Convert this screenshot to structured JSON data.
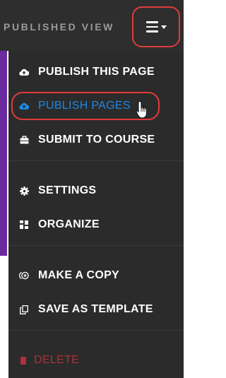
{
  "header": {
    "title": "PUBLISHED VIEW",
    "menu_toggle": "hamburger-menu"
  },
  "menu": {
    "items": [
      {
        "label": "PUBLISH THIS PAGE",
        "icon": "cloud-upload-icon"
      },
      {
        "label": "PUBLISH PAGES",
        "icon": "cloud-upload-icon",
        "state": "hovered"
      },
      {
        "label": "SUBMIT TO COURSE",
        "icon": "briefcase-icon"
      },
      {
        "label": "SETTINGS",
        "icon": "gear-icon"
      },
      {
        "label": "ORGANIZE",
        "icon": "grid-icon"
      },
      {
        "label": "MAKE A COPY",
        "icon": "copy-circle-icon"
      },
      {
        "label": "SAVE AS TEMPLATE",
        "icon": "duplicate-icon"
      },
      {
        "label": "DELETE",
        "icon": "trash-icon"
      }
    ]
  },
  "colors": {
    "menu_background": "#2b2b2b",
    "header_background": "#2e2e2e",
    "active_item": "#1e88e5",
    "danger_item": "#b0303a",
    "highlight_ring": "#e03a3a",
    "accent_bar": "#6a2aa0"
  }
}
